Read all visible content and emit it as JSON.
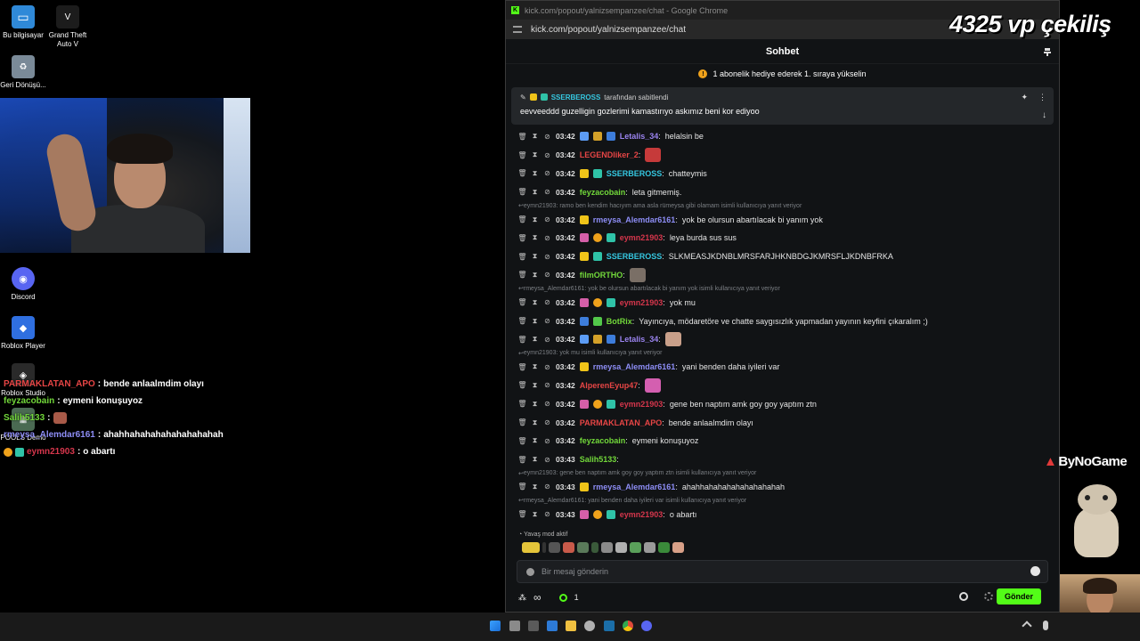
{
  "desktop": {
    "icons": [
      {
        "label": "Bu bilgisayar"
      },
      {
        "label": "Grand Theft Auto V"
      },
      {
        "label": "Geri Dönüşü..."
      },
      {
        "label": "Discord"
      },
      {
        "label": "Roblox Player"
      },
      {
        "label": "Roblox Studio"
      },
      {
        "label": "POOLS Demo"
      }
    ]
  },
  "overlay_chat": [
    {
      "user": "PARMAKLATAN_APO",
      "sep": " : ",
      "text": "bende anlaalmdim olayı",
      "color": "#e64545"
    },
    {
      "user": "feyzacobain",
      "sep": " : ",
      "text": "eymeni konuşuyoz",
      "color": "#72d83a"
    },
    {
      "user": "Salih5133",
      "sep": " : ",
      "text": "",
      "color": "#72d83a"
    },
    {
      "user": "rmeysa_Alemdar6161",
      "sep": " : ",
      "text": "ahahhahahahahahahahahah",
      "color": "#8d8df5"
    },
    {
      "user": "eymn21903",
      "sep": " : ",
      "text": "o abartı",
      "color": "#d6364c"
    }
  ],
  "browser": {
    "title": "kick.com/popout/yalnizsempanzee/chat - Google Chrome",
    "url": "kick.com/popout/yalnizsempanzee/chat"
  },
  "chat": {
    "header": "Sohbet",
    "sub_banner": "1 abonelik hediye ederek 1. sıraya yükselin",
    "pinned": {
      "by_user": "SSERBEROSS",
      "by_suffix": "tarafından sabitlendi",
      "text": "eevveeddd guzelligin gozlerimi kamastırıyo askımız beni kor ediyoo"
    },
    "messages": [
      {
        "type": "msg",
        "time": "03:42",
        "user": "Letalis_34",
        "color": "#9b84f0",
        "text": "helalsin be",
        "badges": [
          "#5c9cf5",
          "#d4a129",
          "#3d7ddb"
        ]
      },
      {
        "type": "msg",
        "time": "03:42",
        "user": "LEGENDliker_2",
        "color": "#e64545",
        "text": "",
        "emote": "#c63a3a"
      },
      {
        "type": "msg",
        "time": "03:42",
        "user": "SSERBEROSS",
        "color": "#35c7e0",
        "text": "chatteymis",
        "badges": [
          "#f0c419",
          "#2fc3a8"
        ]
      },
      {
        "type": "msg",
        "time": "03:42",
        "user": "feyzacobain",
        "color": "#72d83a",
        "text": "leta gitmemiş."
      },
      {
        "type": "reply",
        "text": "eymn21903: ramo ben kendim hacıyım ama asla rümeysa gibi olamam isimli kullanıcıya yanıt veriyor"
      },
      {
        "type": "msg",
        "time": "03:42",
        "user": "rmeysa_Alemdar6161",
        "color": "#8d8df5",
        "text": "yok be olursun abartılacak bi yanım yok",
        "badges": [
          "#f0c419"
        ]
      },
      {
        "type": "msg",
        "time": "03:42",
        "user": "eymn21903",
        "color": "#d6364c",
        "text": "leya burda sus sus",
        "badges": [
          "#d55fa8",
          "#f0a21b",
          "#2fc3a8"
        ]
      },
      {
        "type": "msg",
        "time": "03:42",
        "user": "SSERBEROSS",
        "color": "#35c7e0",
        "text": "SLKMEASJKDNBLMRSFARJHKNBDGJKMRSFLJKDNBFRKA",
        "badges": [
          "#f0c419",
          "#2fc3a8"
        ]
      },
      {
        "type": "msg",
        "time": "03:42",
        "user": "filmORTHO",
        "color": "#72d83a",
        "text": "",
        "emote": "#7a6f66"
      },
      {
        "type": "reply",
        "text": "rmeysa_Alemdar6161: yok be olursun abartılacak bi yanım yok isimli kullanıcıya yanıt veriyor"
      },
      {
        "type": "msg",
        "time": "03:42",
        "user": "eymn21903",
        "color": "#d6364c",
        "text": "yok mu",
        "badges": [
          "#d55fa8",
          "#f0a21b",
          "#2fc3a8"
        ]
      },
      {
        "type": "msg",
        "time": "03:42",
        "user": "BotRix",
        "color": "#72d83a",
        "text": "Yayıncıya, mödaretöre ve chatte saygısızlık yapmadan yayının keyfini çıkaralım ;)",
        "badges": [
          "#3d7ddb",
          "#53c84a"
        ]
      },
      {
        "type": "msg",
        "time": "03:42",
        "user": "Letalis_34",
        "color": "#9b84f0",
        "text": "",
        "badges": [
          "#5c9cf5",
          "#d4a129",
          "#3d7ddb"
        ],
        "emote": "#c9a08a"
      },
      {
        "type": "reply",
        "text": "eymn21903: yok mu isimli kullanıcıya yanıt veriyor"
      },
      {
        "type": "msg",
        "time": "03:42",
        "user": "rmeysa_Alemdar6161",
        "color": "#8d8df5",
        "text": "yani benden daha iyileri var",
        "badges": [
          "#f0c419"
        ]
      },
      {
        "type": "msg",
        "time": "03:42",
        "user": "AlperenEyup47",
        "color": "#e64545",
        "text": "",
        "emote": "#d45fb0"
      },
      {
        "type": "msg",
        "time": "03:42",
        "user": "eymn21903",
        "color": "#d6364c",
        "text": "gene ben naptım amk goy goy yaptım ztn",
        "badges": [
          "#d55fa8",
          "#f0a21b",
          "#2fc3a8"
        ]
      },
      {
        "type": "msg",
        "time": "03:42",
        "user": "PARMAKLATAN_APO",
        "color": "#e64545",
        "text": "bende anlaalmdim olayı"
      },
      {
        "type": "msg",
        "time": "03:42",
        "user": "feyzacobain",
        "color": "#72d83a",
        "text": "eymeni konuşuyoz"
      },
      {
        "type": "msg",
        "time": "03:43",
        "user": "Salih5133",
        "color": "#72d83a",
        "text": ""
      },
      {
        "type": "reply",
        "text": "eymn21903: gene ben naptım amk goy goy yaptım ztn isimli kullanıcıya yanıt veriyor"
      },
      {
        "type": "msg",
        "time": "03:43",
        "user": "rmeysa_Alemdar6161",
        "color": "#8d8df5",
        "text": "ahahhahahahahahahahahah",
        "badges": [
          "#f0c419"
        ]
      },
      {
        "type": "reply",
        "text": "rmeysa_Alemdar6161: yani benden daha iyileri var isimli kullanıcıya yanıt veriyor"
      },
      {
        "type": "msg",
        "time": "03:43",
        "user": "eymn21903",
        "color": "#d6364c",
        "text": "o abartı",
        "badges": [
          "#d55fa8",
          "#f0a21b",
          "#2fc3a8"
        ]
      }
    ],
    "slow_mode": "Yavaş mod aktif",
    "input_placeholder": "Bir mesaj gönderin",
    "footer_infinity": "∞",
    "footer_count": "1",
    "send_label": "Gönder"
  },
  "overlays": {
    "giveaway": "4325 vp çekiliş",
    "brand": "ByNoGame"
  },
  "colors": {
    "accent": "#53fc18",
    "chat_bg": "#111315"
  }
}
